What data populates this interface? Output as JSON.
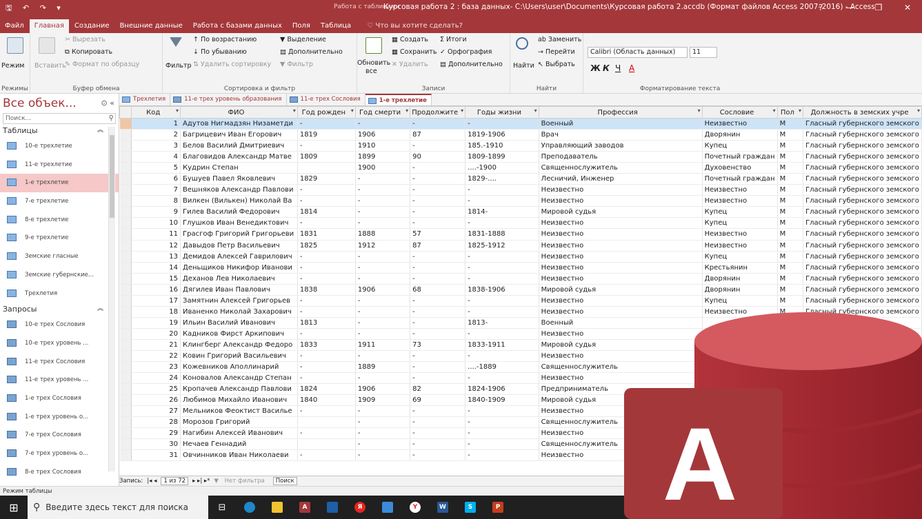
{
  "window": {
    "title": "Курсовая работа 2 : база данных- C:\\Users\\user\\Documents\\Курсовая работа 2.accdb (Формат файлов Access 2007–2016) - Access",
    "context_label": "Работа с таблицами",
    "help": "?",
    "minimize": "—",
    "restore": "❐",
    "close": "✕"
  },
  "ribbon_tabs": [
    "Файл",
    "Главная",
    "Создание",
    "Внешние данные",
    "Работа с базами данных",
    "Поля",
    "Таблица"
  ],
  "tell_me": "Что вы хотите сделать?",
  "ribbon": {
    "views": {
      "label": "Режим",
      "group": "Режимы"
    },
    "clipboard": {
      "cut": "Вырезать",
      "copy": "Копировать",
      "paste": "Вставить",
      "format_painter": "Формат по образцу",
      "group": "Буфер обмена"
    },
    "sort": {
      "filter": "Фильтр",
      "asc": "По возрастанию",
      "desc": "По убыванию",
      "remove_sort": "Удалить сортировку",
      "selection": "Выделение",
      "advanced": "Дополнительно",
      "toggle_filter": "Фильтр",
      "group": "Сортировка и фильтр"
    },
    "records": {
      "refresh": "Обновить",
      "refresh2": "все",
      "new": "Создать",
      "save": "Сохранить",
      "delete": "Удалить",
      "totals": "Итоги",
      "spelling": "Орфография",
      "more": "Дополнительно",
      "group": "Записи"
    },
    "find": {
      "find": "Найти",
      "replace": "Заменить",
      "goto": "Перейти",
      "select": "Выбрать",
      "group": "Найти"
    },
    "text": {
      "font": "Calibri (Область данных)",
      "size": "11",
      "bold": "Ж",
      "italic": "К",
      "underline": "Ч",
      "font_color": "А",
      "group": "Форматирование текста"
    }
  },
  "nav": {
    "title": "Все объек...",
    "search_placeholder": "Поиск...",
    "tables_header": "Таблицы",
    "tables": [
      "10-е трехлетие",
      "11-е трехлетие",
      "1-е трехлетие",
      "7-е трехлетие",
      "8-е трехлетие",
      "9-е трехлетие",
      "Земские гласные",
      "Земские губернские...",
      "Трехлетия"
    ],
    "queries_header": "Запросы",
    "queries": [
      "10-е трех Сословия",
      "10-е трех уровень ...",
      "11-е трех Сословия",
      "11-е трех уровень ...",
      "1-е трех Сословия",
      "1-е трех уровень о...",
      "7-е трех Сословия",
      "7-е трех уровень о...",
      "8-е трех Сословия",
      "8-е трех уровень о..."
    ]
  },
  "doc_tabs": [
    "Трехлетия",
    "11-е трех уровень образования",
    "11-е трех Сословия",
    "1-е трехлетие"
  ],
  "columns": [
    "Код",
    "ФИО",
    "Год рожден",
    "Год смерти",
    "Продолжите",
    "Годы жизни",
    "Профессия",
    "Сословие",
    "Пол",
    "Должность в земских учре"
  ],
  "rows": [
    [
      "1",
      "Адутов Нигмадзян Низаметди",
      "-",
      "-",
      "-",
      "-",
      "Военный",
      "Неизвестно",
      "М",
      "Гласный губернского земского"
    ],
    [
      "2",
      "Багрицевич Иван Егорович",
      "1819",
      "1906",
      "87",
      "1819-1906",
      "Врач",
      "Дворянин",
      "М",
      "Гласный губернского земского"
    ],
    [
      "3",
      "Белов Василий Дмитриевич",
      "-",
      "1910",
      "-",
      "185.-1910",
      "Управляющий заводов",
      "Купец",
      "М",
      "Гласный губернского земского"
    ],
    [
      "4",
      "Благовидов Александр Матве",
      "1809",
      "1899",
      "90",
      "1809-1899",
      "Преподаватель",
      "Почетный граждан",
      "М",
      "Гласный губернского земского"
    ],
    [
      "5",
      "Кудрин Степан",
      "",
      "1900",
      "-",
      "....-1900",
      "Священнослужитель",
      "Духовенство",
      "М",
      "Гласный губернского земского"
    ],
    [
      "6",
      "Бушуев Павел Яковлевич",
      "1829",
      "-",
      "-",
      "1829-....",
      "Лесничий, Инженер",
      "Почетный граждан",
      "М",
      "Гласный губернского земского"
    ],
    [
      "7",
      "Вешняков Александр Павлови",
      "-",
      "-",
      "-",
      "-",
      "Неизвестно",
      "Неизвестно",
      "М",
      "Гласный губернского земского"
    ],
    [
      "8",
      "Вилкен (Вилькен) Николай Ва",
      "-",
      "-",
      "-",
      "-",
      "Неизвестно",
      "Неизвестно",
      "М",
      "Гласный губернского земского"
    ],
    [
      "9",
      "Гилев Василий Федорович",
      "1814",
      "-",
      "-",
      "1814-",
      "Мировой судья",
      "Купец",
      "М",
      "Гласный губернского земского"
    ],
    [
      "10",
      "Глушков Иван Венедиктович",
      "-",
      "-",
      "-",
      "-",
      "Неизвестно",
      "Купец",
      "М",
      "Гласный губернского земского"
    ],
    [
      "11",
      "Грасгоф Григорий Григорьеви",
      "1831",
      "1888",
      "57",
      "1831-1888",
      "Неизвестно",
      "Неизвестно",
      "М",
      "Гласный губернского земского"
    ],
    [
      "12",
      "Давыдов Петр Васильевич",
      "1825",
      "1912",
      "87",
      "1825-1912",
      "Неизвестно",
      "Неизвестно",
      "М",
      "Гласный губернского земского"
    ],
    [
      "13",
      "Демидов Алексей Гаврилович",
      "-",
      "-",
      "-",
      "-",
      "Неизвестно",
      "Купец",
      "М",
      "Гласный губернского земского"
    ],
    [
      "14",
      "Деньщиков Никифор Иванови",
      "-",
      "-",
      "-",
      "-",
      "Неизвестно",
      "Крестьянин",
      "М",
      "Гласный губернского земского"
    ],
    [
      "15",
      "Деханов Лев Николаевич",
      "-",
      "-",
      "-",
      "-",
      "Неизвестно",
      "Дворянин",
      "М",
      "Гласный губернского земского"
    ],
    [
      "16",
      "Дягилев Иван Павлович",
      "1838",
      "1906",
      "68",
      "1838-1906",
      "Мировой судья",
      "Дворянин",
      "М",
      "Гласный губернского земского"
    ],
    [
      "17",
      "Замятнин Алексей Григорьев",
      "-",
      "-",
      "-",
      "-",
      "Неизвестно",
      "Купец",
      "М",
      "Гласный губернского земского"
    ],
    [
      "18",
      "Иваненко Николай Захарович",
      "-",
      "-",
      "-",
      "-",
      "Неизвестно",
      "Неизвестно",
      "М",
      "Гласный губернского земского"
    ],
    [
      "19",
      "Ильин Василий Иванович",
      "1813",
      "-",
      "-",
      "1813-",
      "Военный",
      "",
      "",
      ""
    ],
    [
      "20",
      "Кадников Фирст Аркипович",
      "-",
      "-",
      "-",
      "-",
      "Неизвестно",
      "",
      "",
      ""
    ],
    [
      "21",
      "Клингберг Александр Федоро",
      "1833",
      "1911",
      "73",
      "1833-1911",
      "Мировой судья",
      "",
      "",
      ""
    ],
    [
      "22",
      "Ковин Григорий Васильевич",
      "-",
      "-",
      "-",
      "-",
      "Неизвестно",
      "",
      "",
      ""
    ],
    [
      "23",
      "Кожевников Аполлинарий",
      "-",
      "1889",
      "-",
      "....-1889",
      "Священнослужитель",
      "",
      "",
      ""
    ],
    [
      "24",
      "Коновалов Александр Степан",
      "-",
      "-",
      "-",
      "-",
      "Неизвестно",
      "",
      "",
      ""
    ],
    [
      "25",
      "Кропачев Александр Павлови",
      "1824",
      "1906",
      "82",
      "1824-1906",
      "Предприниматель",
      "",
      "",
      ""
    ],
    [
      "26",
      "Любимов Михайло Иванович",
      "1840",
      "1909",
      "69",
      "1840-1909",
      "Мировой судья",
      "",
      "",
      ""
    ],
    [
      "27",
      "Мельников Феоктист Василье",
      "-",
      "-",
      "-",
      "-",
      "Неизвестно",
      "",
      "",
      ""
    ],
    [
      "28",
      "Морозов Григорий",
      "",
      "-",
      "-",
      "-",
      "Священнослужитель",
      "",
      "",
      ""
    ],
    [
      "29",
      "Нагибин Алексей Иванович",
      "-",
      "-",
      "-",
      "-",
      "Неизвестно",
      "",
      "",
      ""
    ],
    [
      "30",
      "Нечаев Геннадий",
      "",
      "-",
      "-",
      "-",
      "Священнослужитель",
      "",
      "",
      ""
    ],
    [
      "31",
      "Овчинников Иван Николаеви",
      "-",
      "-",
      "-",
      "-",
      "Неизвестно",
      "",
      "",
      ""
    ]
  ],
  "record_nav": {
    "label": "Запись:",
    "position": "1 из 72",
    "filter": "Нет фильтра",
    "search": "Поиск"
  },
  "status": "Режим таблицы",
  "taskbar": {
    "search_placeholder": "Введите здесь текст для поиска"
  },
  "logo": {
    "letter": "A",
    "color": "#a4373a"
  }
}
